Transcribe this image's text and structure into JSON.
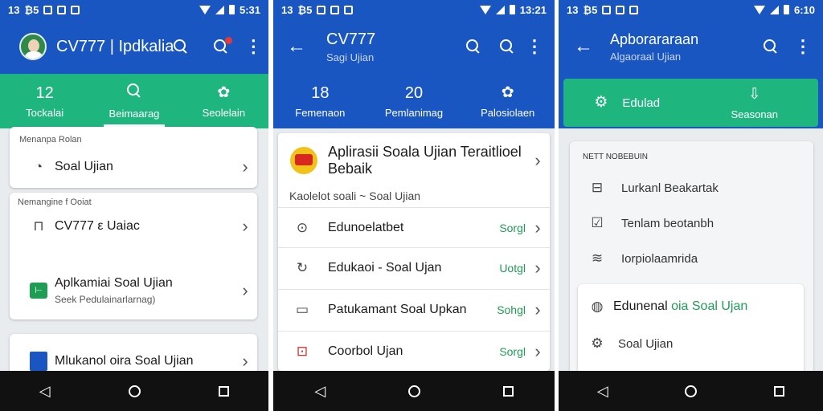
{
  "colors": {
    "brand_blue": "#1a56c2",
    "accent_green": "#1fb57f",
    "tag_green": "#1f9d55",
    "nav_black": "#111111",
    "surface": "#ffffff"
  },
  "screens": [
    {
      "status": {
        "time_left": "13",
        "digits": "₿5",
        "clock": "5:31"
      },
      "appbar": {
        "title": "CV777 | Ipdkalia"
      },
      "stats": [
        {
          "num": "12",
          "label": "Tockalai"
        },
        {
          "icon": "search-icon",
          "label": "Beimaarag",
          "active": true
        },
        {
          "icon": "gear-icon",
          "label": "Seolelain"
        }
      ],
      "section1": {
        "label": "Menanpa Rolan",
        "row": {
          "icon": "clock-icon",
          "text": "Soal Ujian"
        }
      },
      "section2": {
        "label": "Nemangine f Ooiat",
        "rows": [
          {
            "icon": "bag-icon",
            "text": "CV777 ε Uaiac"
          },
          {
            "icon": "app-icon",
            "text": "Aplkamiai Soal Ujian",
            "sub": "Seek Pedulainarlarnag)"
          }
        ]
      },
      "section3": {
        "row": {
          "icon": "doc-icon",
          "text": "Mlukanol oira Soal Ujian"
        }
      }
    },
    {
      "status": {
        "time_left": "13",
        "digits": "₿5",
        "clock": "13:21"
      },
      "appbar": {
        "title": "CV777",
        "subtitle": "Sagi Ujian"
      },
      "stats": [
        {
          "num": "18",
          "label": "Femenaon"
        },
        {
          "num": "20",
          "label": "Pemlanimag"
        },
        {
          "icon": "gear-icon",
          "label": "Palosiolaen"
        }
      ],
      "header_card": {
        "title": "Aplirasii Soala Ujian Teraitlioel Bebaik",
        "subtitle": "Kaolelot soali ~ Soal Ujian"
      },
      "rows": [
        {
          "icon": "pin-icon",
          "text": "Edunoelatbet",
          "tag": "Sorgl"
        },
        {
          "icon": "refresh-icon",
          "text": "Edukaoi - Soal Ujan",
          "tag": "Uotgl",
          "text_color": "#1a56c2"
        },
        {
          "icon": "doc-icon",
          "text": "Patukamant Soal Upkan",
          "tag": "Sohgl",
          "text_color": "#1f9d55"
        },
        {
          "icon": "bag-icon",
          "text": "Coorbol Ujan",
          "tag": "Sorgl"
        }
      ]
    },
    {
      "status": {
        "time_left": "13",
        "digits": "₿5",
        "clock": "6:10"
      },
      "appbar": {
        "title": "Apborararaan",
        "subtitle": "Algaoraal Ujian"
      },
      "stats": [
        {
          "icon": "gear-icon",
          "label": "Edulad"
        },
        {
          "icon": "download-icon",
          "label": "Seasonan"
        }
      ],
      "card1": {
        "label": "NETT NOBEBUIN",
        "rows": [
          {
            "icon": "box-icon",
            "text": "Lurkanl Beakartak"
          },
          {
            "icon": "check-icon",
            "text": "Tenlam beotanbh"
          },
          {
            "icon": "bridge-icon",
            "text": "Iorpiolaamrida"
          }
        ]
      },
      "card2": {
        "rows": [
          {
            "icon": "refresh-icon",
            "text_a": "Edunenal",
            "text_b": "oia Soal Ujan"
          },
          {
            "icon": "gear-icon",
            "text": "Soal Ujian"
          }
        ]
      }
    }
  ]
}
